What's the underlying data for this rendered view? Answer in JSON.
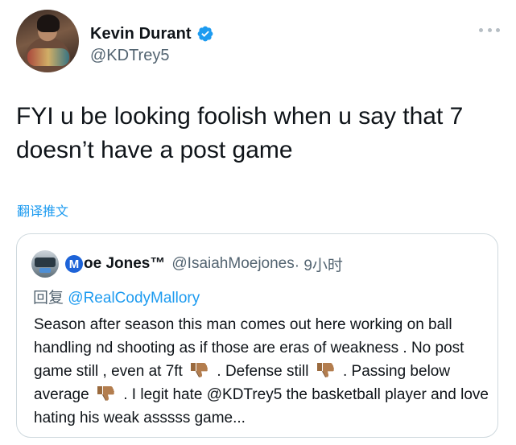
{
  "tweet": {
    "author_name": "Kevin Durant",
    "author_handle": "@KDTrey5",
    "text_line1": "FYI u be looking foolish when u say that 7",
    "text_line2": "doesn’t have a post game",
    "translate_label": "翻译推文"
  },
  "quoted_tweet": {
    "badge_letter": "M",
    "author_name": "oe Jones™",
    "author_handle": "@IsaiahMoejones",
    "time": "· 9小时",
    "reply_prefix": "回复",
    "reply_mention": "@RealCodyMallory",
    "body": {
      "p1": "Season after season this man comes out here working on ball handling nd shooting as if those are eras of weakness . No post game still , even at 7ft",
      "p2": ". Defense still",
      "p3": ". Passing below average",
      "p4": ". I legit hate @KDTrey5 the basketball player and love hating his weak asssss game..."
    }
  },
  "colors": {
    "accent": "#1d9bf0",
    "secondary_text": "#536471",
    "border": "#cfd9de",
    "verified_badge": "#1d9bf0"
  },
  "icons": {
    "verified": "verified-badge-icon",
    "more": "more-options-icon",
    "thumbs_down": "thumbs-down-emoji-icon"
  }
}
